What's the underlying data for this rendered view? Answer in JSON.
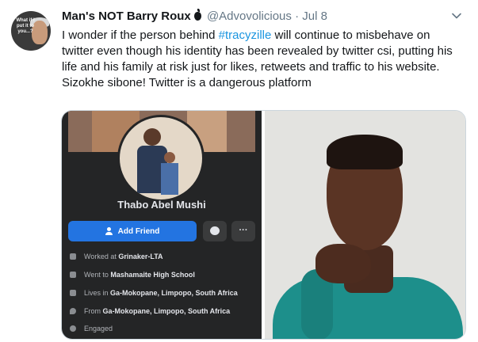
{
  "tweet": {
    "display_name": "Man's NOT Barry Roux",
    "handle": "@Advovolicious",
    "separator": "·",
    "date": "Jul 8",
    "avatar_text": "What if I put it to you...?",
    "text_before": "I wonder if the person behind ",
    "hashtag": "#tracyzille",
    "text_after": " will continue to misbehave on twitter even though his identity has been revealed by twitter csi, putting his life and his family at risk just for likes, retweets and traffic to his website.",
    "line2": "Sizokhe sibone! Twitter is a dangerous platform"
  },
  "facebook": {
    "name": "Thabo Abel Mushi",
    "add_friend": "Add Friend",
    "more": "···",
    "details": [
      {
        "icon": "briefcase-icon",
        "prefix": "Worked at ",
        "value": "Grinaker-LTA"
      },
      {
        "icon": "graduation-cap-icon",
        "prefix": "Went to ",
        "value": "Mashamaite High School"
      },
      {
        "icon": "home-icon",
        "prefix": "Lives in ",
        "value": "Ga-Mokopane, Limpopo, South Africa"
      },
      {
        "icon": "location-pin-icon",
        "prefix": "From ",
        "value": "Ga-Mokopane, Limpopo, South Africa"
      },
      {
        "icon": "heart-icon",
        "prefix": "",
        "value": "Engaged"
      }
    ]
  },
  "colors": {
    "hashtag": "#1b95e0",
    "muted": "#657786",
    "fb_bg": "#242526",
    "fb_button": "#2374e1"
  }
}
